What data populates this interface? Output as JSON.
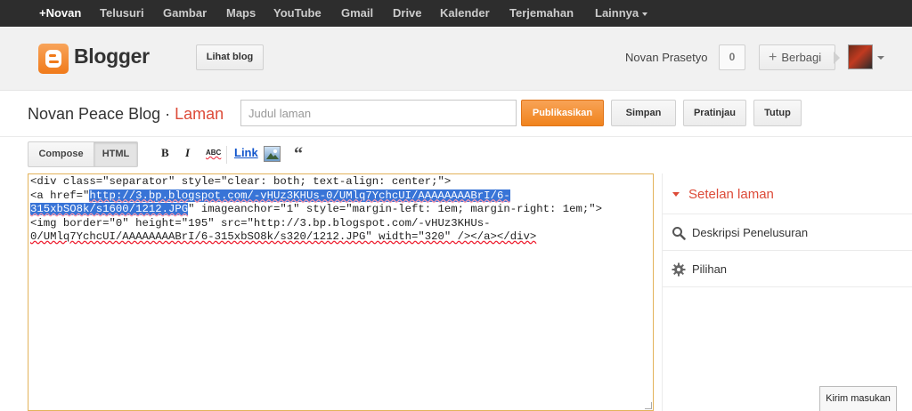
{
  "gbar": {
    "items": [
      "+Novan",
      "Telusuri",
      "Gambar",
      "Maps",
      "YouTube",
      "Gmail",
      "Drive",
      "Kalender",
      "Terjemahan",
      "Lainnya"
    ]
  },
  "header": {
    "brand": "Blogger",
    "view_blog": "Lihat blog",
    "username": "Novan Prasetyo",
    "notification_count": "0",
    "share_label": "Berbagi"
  },
  "post": {
    "blog_name": "Novan Peace Blog",
    "separator": " · ",
    "section": "Laman",
    "title_placeholder": "Judul laman",
    "publish": "Publikasikan",
    "save": "Simpan",
    "preview": "Pratinjau",
    "close": "Tutup"
  },
  "toolbar": {
    "compose": "Compose",
    "html": "HTML",
    "bold": "B",
    "italic": "I",
    "spellcheck": "ABC",
    "link": "Link"
  },
  "editor": {
    "line1": "<div class=\"separator\" style=\"clear: both; text-align: center;\">",
    "line2_pre": "<a href=\"",
    "line2_sel": "http://3.bp.blogspot.com/-vHUz3KHUs-0/UMlq7YchcUI/AAAAAAAABrI/6-",
    "line3_sel": "315xbSO8k/s1600/1212.JPG",
    "line3_post": "\" imageanchor=\"1\" style=\"margin-left: 1em; margin-right: 1em;\">",
    "line4": "<img border=\"0\" height=\"195\" src=\"http://3.bp.blogspot.com/-vHUz3KHUs-",
    "line5": "0/UMlq7YchcUI/AAAAAAAABrI/6-315xbSO8k/s320/1212.JPG\" width=\"320\" /></a></div>"
  },
  "sidebar": {
    "heading": "Setelan laman",
    "items": [
      "Deskripsi Penelusuran",
      "Pilihan"
    ]
  },
  "feedback": "Kirim masukan",
  "colors": {
    "accent": "#dd4b39",
    "publish": "#f0831d",
    "selection": "#3874d7",
    "editor_border": "#e3b35a",
    "gbar": "#2d2d2d"
  }
}
